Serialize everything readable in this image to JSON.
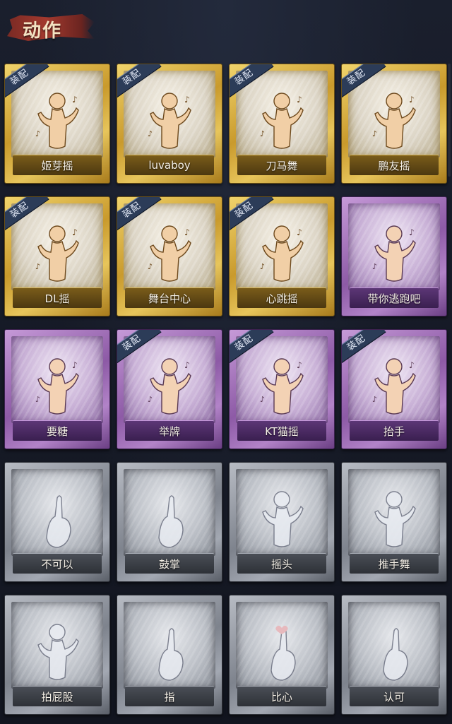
{
  "header": {
    "title": "动作"
  },
  "equipped_tag": "装配",
  "colors": {
    "gold": "#d9b245",
    "purple": "#9b6bb5",
    "gray": "#9ea3ab"
  },
  "emotes": [
    {
      "name": "姬芽摇",
      "rarity": "gold",
      "equipped": true,
      "icon": "dance-figure-icon"
    },
    {
      "name": "luvaboy",
      "rarity": "gold",
      "equipped": true,
      "icon": "dance-figure-icon"
    },
    {
      "name": "刀马舞",
      "rarity": "gold",
      "equipped": true,
      "icon": "dance-figure-icon"
    },
    {
      "name": "鹏友摇",
      "rarity": "gold",
      "equipped": true,
      "icon": "dance-figure-icon"
    },
    {
      "name": "DL摇",
      "rarity": "gold",
      "equipped": true,
      "icon": "dance-figure-icon"
    },
    {
      "name": "舞台中心",
      "rarity": "gold",
      "equipped": true,
      "icon": "dance-figure-icon"
    },
    {
      "name": "心跳摇",
      "rarity": "gold",
      "equipped": true,
      "icon": "dance-figure-icon"
    },
    {
      "name": "带你逃跑吧",
      "rarity": "purple",
      "equipped": false,
      "icon": "pointing-figure-icon"
    },
    {
      "name": "要糖",
      "rarity": "purple",
      "equipped": false,
      "icon": "reaching-figure-icon"
    },
    {
      "name": "举牌",
      "rarity": "purple",
      "equipped": true,
      "icon": "sign-figure-icon"
    },
    {
      "name": "KT猫摇",
      "rarity": "purple",
      "equipped": true,
      "icon": "dance-figure-icon"
    },
    {
      "name": "抬手",
      "rarity": "purple",
      "equipped": true,
      "icon": "raise-hand-figure-icon"
    },
    {
      "name": "不可以",
      "rarity": "gray",
      "equipped": false,
      "icon": "finger-wag-icon"
    },
    {
      "name": "鼓掌",
      "rarity": "gray",
      "equipped": false,
      "icon": "clap-hands-icon"
    },
    {
      "name": "摇头",
      "rarity": "gray",
      "equipped": false,
      "icon": "shake-head-figure-icon"
    },
    {
      "name": "推手舞",
      "rarity": "gray",
      "equipped": false,
      "icon": "push-hands-figure-icon"
    },
    {
      "name": "拍屁股",
      "rarity": "gray",
      "equipped": false,
      "icon": "bent-figure-icon"
    },
    {
      "name": "指",
      "rarity": "gray",
      "equipped": false,
      "icon": "pointing-hand-icon"
    },
    {
      "name": "比心",
      "rarity": "gray",
      "equipped": false,
      "icon": "finger-heart-icon"
    },
    {
      "name": "认可",
      "rarity": "gray",
      "equipped": false,
      "icon": "thumbs-up-icon"
    }
  ]
}
